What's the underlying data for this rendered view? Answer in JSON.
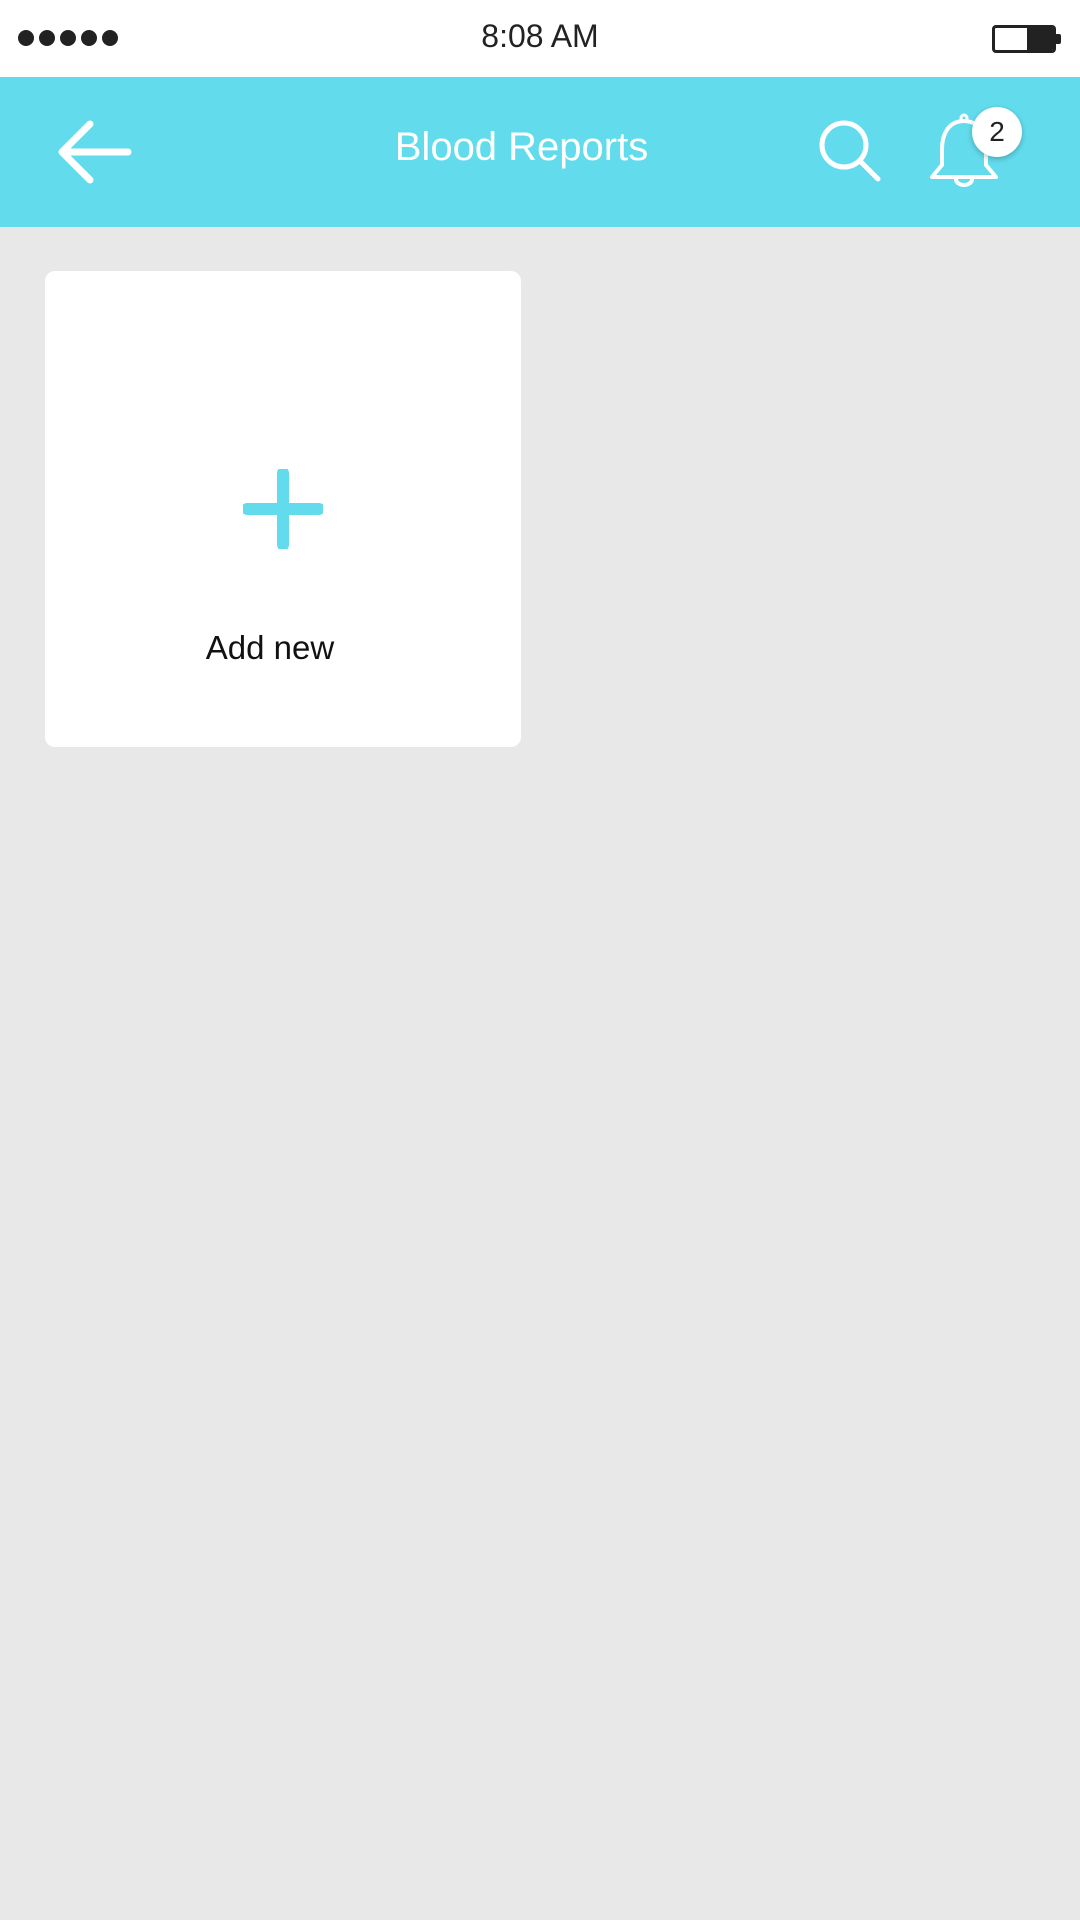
{
  "status_bar": {
    "time": "8:08 AM",
    "signal_bars": 5,
    "battery_level": 0.45,
    "signal_icon": "signal-dots-icon",
    "battery_icon": "battery-icon"
  },
  "header": {
    "title": "Blood Reports",
    "back_icon": "arrow-left-icon",
    "search_icon": "search-icon",
    "notification_icon": "bell-icon",
    "notification_count": "2"
  },
  "main": {
    "add_card": {
      "label": "Add new",
      "icon": "plus-icon"
    }
  },
  "colors": {
    "accent": "#62dcec",
    "background": "#e8e8e8",
    "card": "#ffffff",
    "text_dark": "#111111"
  }
}
